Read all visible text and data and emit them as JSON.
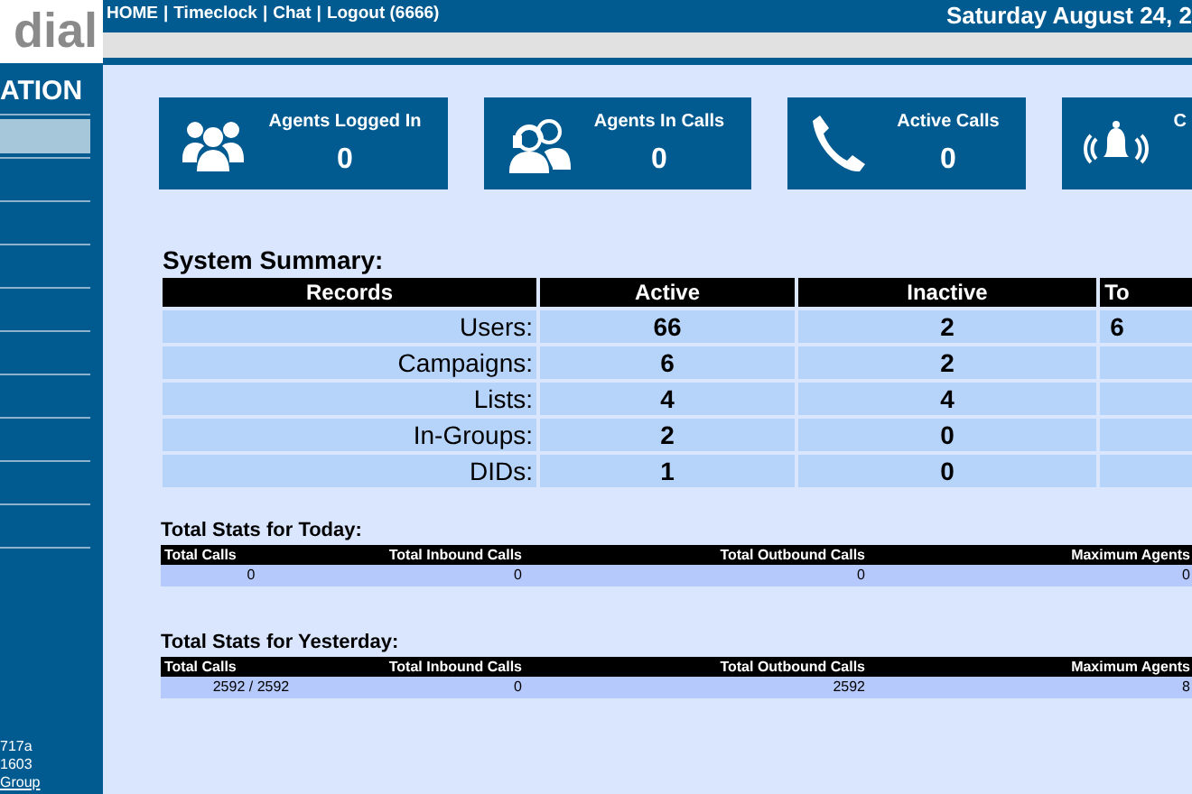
{
  "logo": {
    "text": "dial"
  },
  "header": {
    "links": [
      "HOME",
      "Timeclock",
      "Chat",
      "Logout (6666)"
    ],
    "separator": "|",
    "date": "Saturday August 24, 2"
  },
  "sidebar": {
    "title": "ATION",
    "items": [
      {
        "selected": true
      },
      {
        "selected": false
      },
      {
        "selected": false
      },
      {
        "selected": false
      },
      {
        "selected": false
      },
      {
        "selected": false
      },
      {
        "selected": false
      },
      {
        "selected": false
      },
      {
        "selected": false
      },
      {
        "selected": false
      }
    ],
    "footer": [
      {
        "kind": "text",
        "text": "717a"
      },
      {
        "kind": "text",
        "text": "1603"
      },
      {
        "kind": "link",
        "text": "Group"
      }
    ]
  },
  "cards": [
    {
      "kind": "agents",
      "label": "Agents Logged In",
      "value": "0"
    },
    {
      "kind": "headset",
      "label": "Agents In Calls",
      "value": "0"
    },
    {
      "kind": "phone",
      "label": "Active Calls",
      "value": "0"
    },
    {
      "kind": "bell",
      "label": "C"
    }
  ],
  "summary": {
    "title": "System Summary:",
    "columns": [
      "Records",
      "Active",
      "Inactive",
      "To"
    ],
    "rows": [
      [
        "Users:",
        "66",
        "2",
        "6"
      ],
      [
        "Campaigns:",
        "6",
        "2",
        ""
      ],
      [
        "Lists:",
        "4",
        "4",
        ""
      ],
      [
        "In-Groups:",
        "2",
        "0",
        ""
      ],
      [
        "DIDs:",
        "1",
        "0",
        ""
      ]
    ]
  },
  "stats": [
    {
      "title": "Total Stats for Today:",
      "columns": [
        "Total Calls",
        "Total Inbound Calls",
        "Total Outbound Calls",
        "Maximum Agents"
      ],
      "row": [
        "0",
        "0",
        "0",
        "0"
      ]
    },
    {
      "title": "Total Stats for Yesterday:",
      "columns": [
        "Total Calls",
        "Total Inbound Calls",
        "Total Outbound Calls",
        "Maximum Agents"
      ],
      "row": [
        "2592 / 2592",
        "0",
        "2592",
        "8"
      ]
    }
  ]
}
